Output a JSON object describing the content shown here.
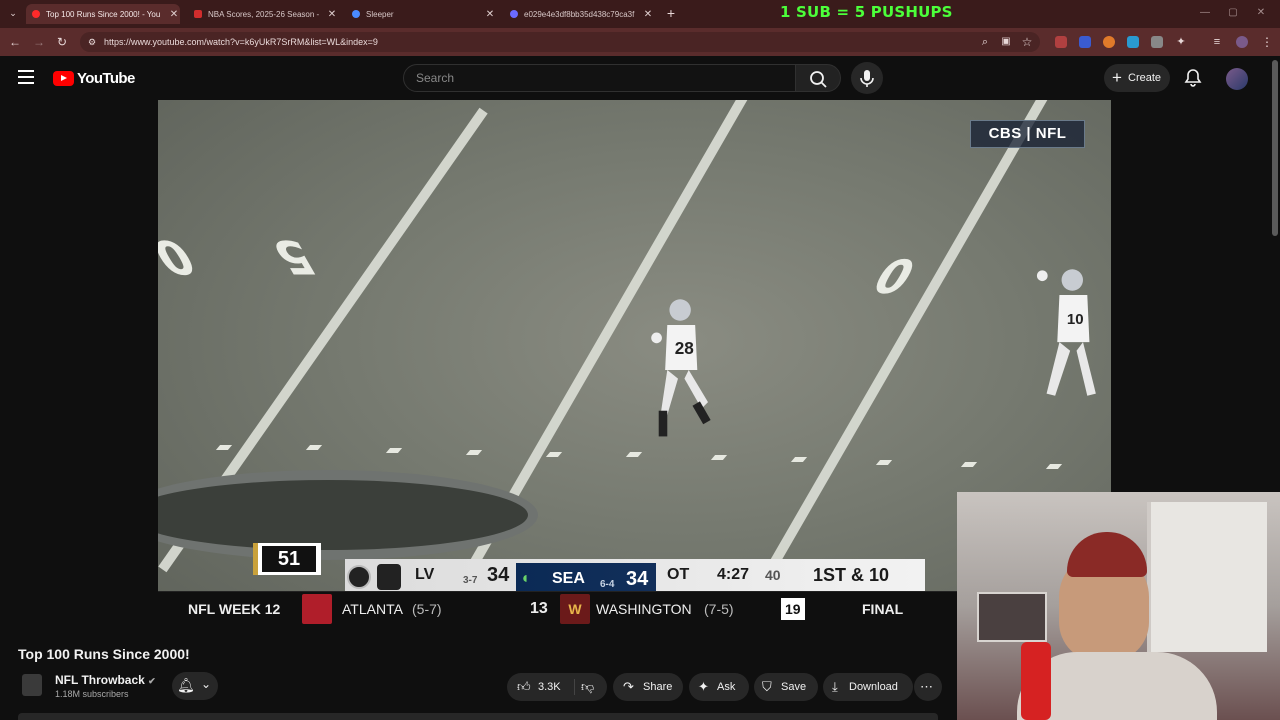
{
  "browser": {
    "tabs": [
      {
        "title": "Top 100 Runs Since 2000! - You",
        "color": "#ff2a2a"
      },
      {
        "title": "NBA Scores, 2025-26 Season -",
        "color": "#d22d2d"
      },
      {
        "title": "Sleeper",
        "color": "#4a8bff"
      },
      {
        "title": "e029e4e3df8bb35d438c79ca3f",
        "color": "#6a6aff"
      }
    ],
    "promo_text": "1 SUB = 5 PUSHUPS",
    "url": "https://www.youtube.com/watch?v=k6yUkR7SrRM&list=WL&index=9"
  },
  "youtube": {
    "brand": "YouTube",
    "search_placeholder": "Search",
    "create_label": "Create"
  },
  "video": {
    "network_logo": "CBS | NFL",
    "down_marker": "51",
    "away_abbr": "LV",
    "away_record": "3-7",
    "away_score": "34",
    "home_abbr": "SEA",
    "home_record": "6-4",
    "home_score": "34",
    "period": "OT",
    "clock": "4:27",
    "play_clock": "40",
    "down_distance": "1ST & 10",
    "ticker": {
      "week": "NFL WEEK 12",
      "team1": "ATLANTA",
      "team1_record": "(5-7)",
      "team1_score": "13",
      "team2": "WASHINGTON",
      "team2_record": "(7-5)",
      "team2_score": "19",
      "status": "FINAL"
    },
    "player_numbers": {
      "runner": "28",
      "trailer": "10"
    }
  },
  "meta": {
    "title": "Top 100 Runs Since 2000!",
    "channel": "NFL Throwback",
    "subscribers": "1.18M subscribers",
    "likes": "3.3K",
    "share_label": "Share",
    "ask_label": "Ask",
    "save_label": "Save",
    "download_label": "Download"
  }
}
